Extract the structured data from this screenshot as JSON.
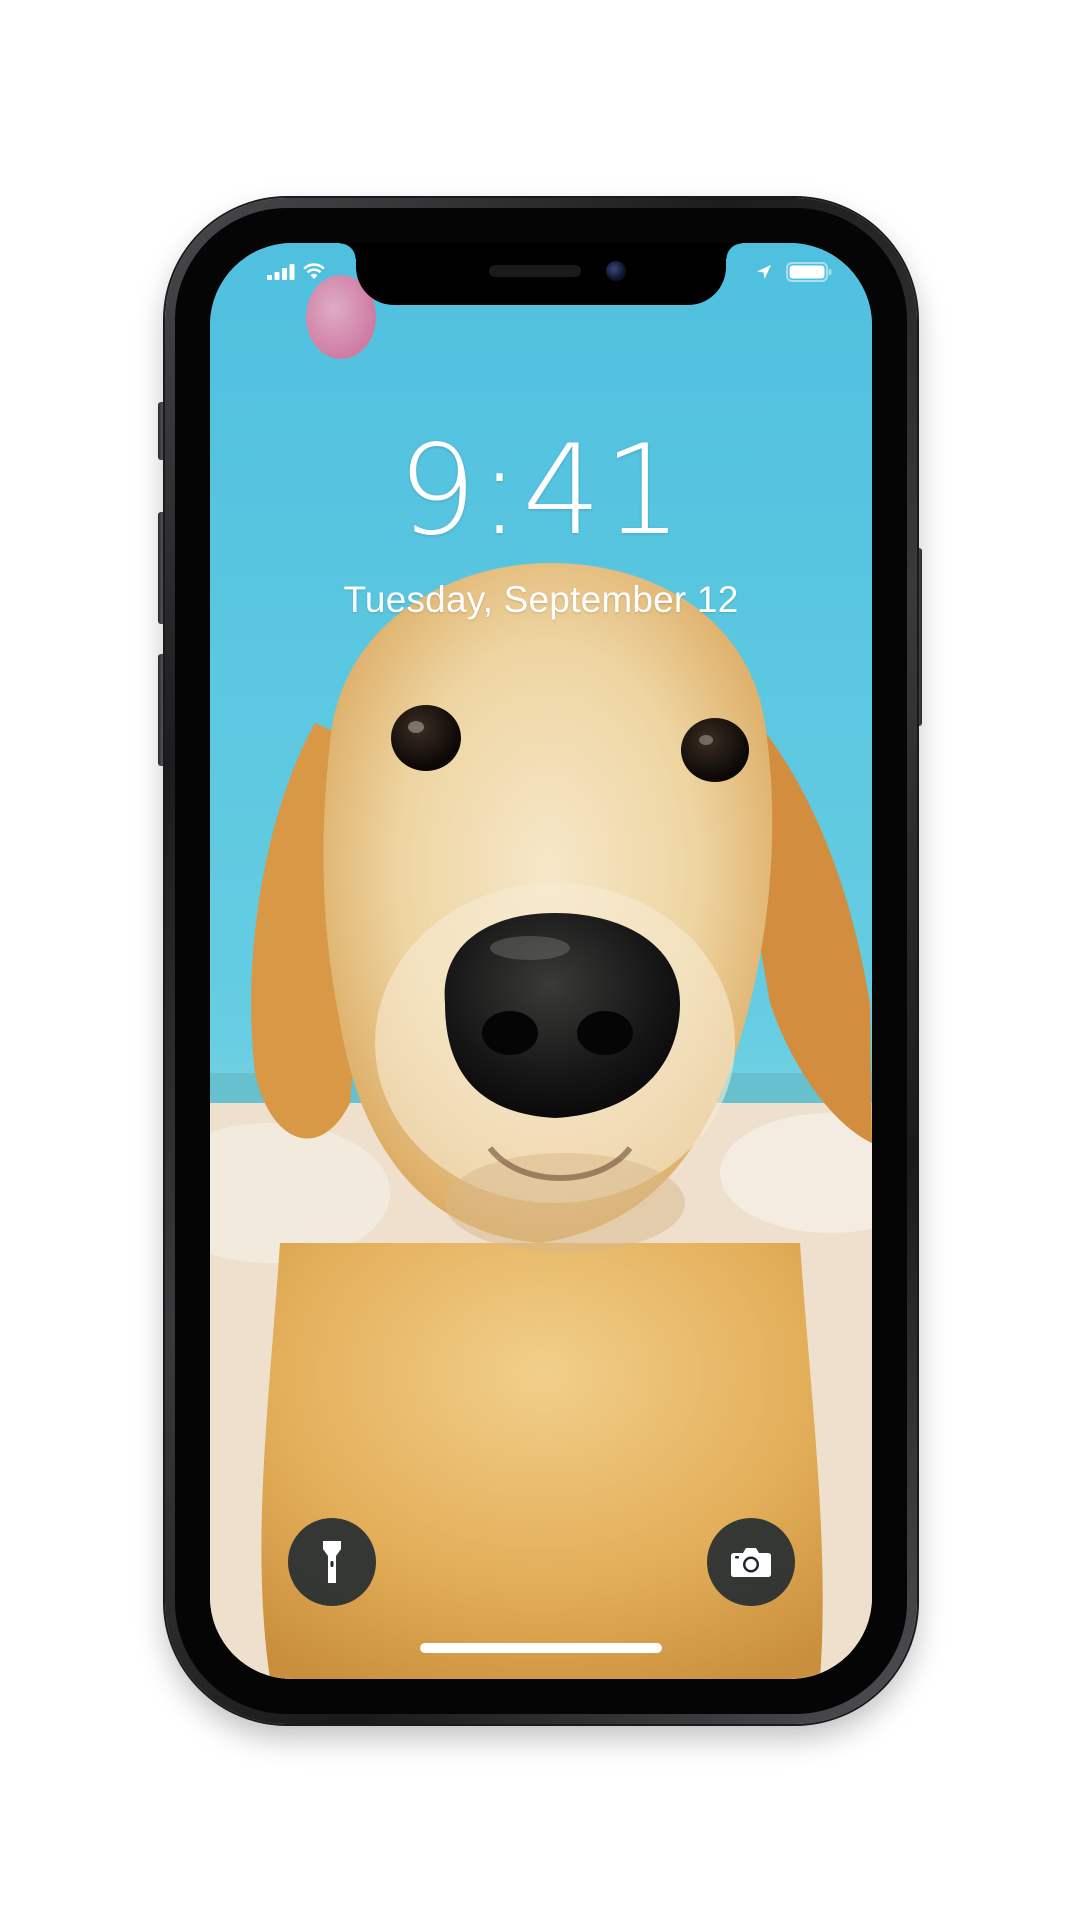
{
  "status_bar": {
    "icons": [
      "signal-icon",
      "wifi-icon",
      "location-arrow-icon",
      "battery-icon"
    ]
  },
  "lock_screen": {
    "time": "9:41",
    "date": "Tuesday, September 12"
  },
  "quick_actions": {
    "left": "flashlight-icon",
    "right": "camera-icon"
  },
  "colors": {
    "sky": "#5ec7e0",
    "dog_fur": "#e9c88c",
    "button_bg": "#1c2830",
    "text": "#ffffff"
  }
}
